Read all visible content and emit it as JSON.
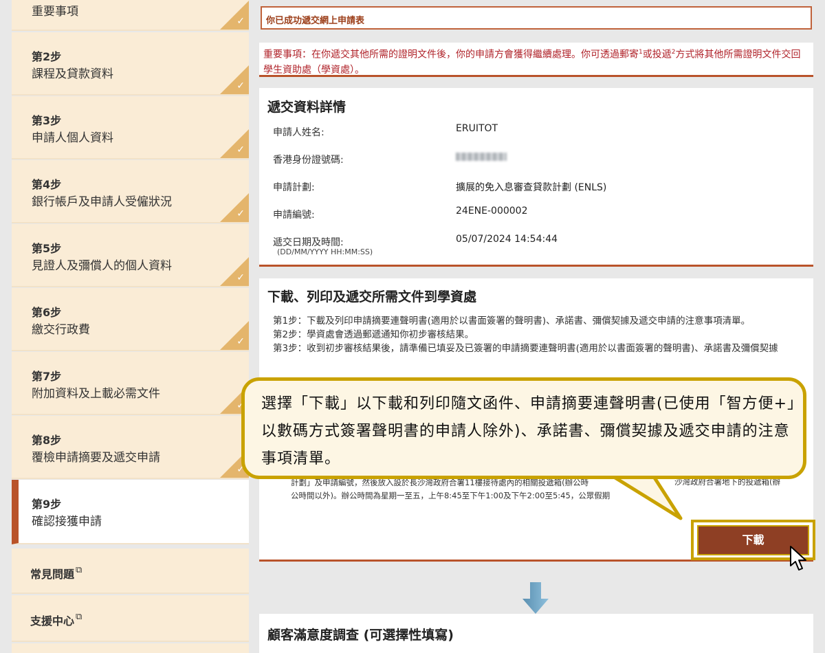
{
  "sidebar": {
    "steps": [
      {
        "num": "",
        "label": "重要事項",
        "done": true
      },
      {
        "num": "第2步",
        "label": "課程及貸款資料",
        "done": true
      },
      {
        "num": "第3步",
        "label": "申請人個人資料",
        "done": true
      },
      {
        "num": "第4步",
        "label": "銀行帳戶及申請人受僱狀況",
        "done": true
      },
      {
        "num": "第5步",
        "label": "見證人及彌償人的個人資料",
        "done": true
      },
      {
        "num": "第6步",
        "label": "繳交行政費",
        "done": true
      },
      {
        "num": "第7步",
        "label": "附加資料及上載必需文件",
        "done": true
      },
      {
        "num": "第8步",
        "label": "覆檢申請摘要及遞交申請",
        "done": true
      },
      {
        "num": "第9步",
        "label": "確認接獲申請",
        "done": false
      }
    ],
    "links": [
      {
        "label": "常見問題"
      },
      {
        "label": "支援中心"
      }
    ],
    "check_glyph": "✓",
    "external_glyph": "⧉"
  },
  "main": {
    "success_message": "你已成功遞交網上申請表",
    "notice": {
      "part1": "重要事項：在你遞交其他所需的證明文件後，你的申請方會獲得繼續處理。你可透過郵寄",
      "sup1": "1",
      "part2": "或投遞",
      "sup2": "2",
      "part3": "方式將其他所需證明文件交回學生資助處（學資處）。"
    },
    "details": {
      "title": "遞交資料詳情",
      "rows": [
        {
          "label": "申請人姓名:",
          "value": "ERUITOT"
        },
        {
          "label": "香港身份證號碼:",
          "value": ""
        },
        {
          "label": "申請計劃:",
          "value": "擴展的免入息審查貸款計劃 (ENLS)"
        },
        {
          "label": "申請編號:",
          "value": "24ENE-000002"
        },
        {
          "label": "遞交日期及時間:",
          "value": "05/07/2024 14:54:44"
        }
      ],
      "date_format": "(DD/MM/YYYY HH:MM:SS)"
    },
    "download_section": {
      "title": "下載、列印及遞交所需文件到學資處",
      "steps_text": [
        "第1步：下載及列印申請摘要連聲明書(適用於以書面簽署的聲明書)、承諾書、彌償契據及遞交申請的注意事項清單。",
        "第2步：學資處會透過郵遞通知你初步審核結果。",
        "第3步：收到初步審核結果後，請準備已填妥及已簽署的申請摘要連聲明書(適用於以書面簽署的聲明書)、承諾書及彌償契據"
      ],
      "tiny_lines": [
        "計劃」及申請編號，然後放入設於長沙灣政府合署11樓接待處內的相關投遞箱(辦公時",
        "公時間以外)。辦公時間為星期一至五，上午8:45至下午1:00及下午2:00至5:45，公眾假期"
      ],
      "tiny_right": "沙灣政府合署地下的投遞箱(辦",
      "download_label": "下載"
    },
    "survey": {
      "title": "顧客滿意度調查 (可選擇性填寫)"
    }
  },
  "callout": {
    "text": "選擇「下載」以下載和列印隨文函件、申請摘要連聲明書(已使用「智方便+」以數碼方式簽署聲明書的申請人除外)、承諾書、彌償契據及遞交申請的注意事項清單。"
  },
  "colors": {
    "accent": "#b9532a",
    "button": "#8e3f24",
    "highlight": "#c9a200",
    "sidebar_bg": "#faecd6",
    "check_bg": "#e4b56c",
    "notice_text": "#b0232a"
  }
}
